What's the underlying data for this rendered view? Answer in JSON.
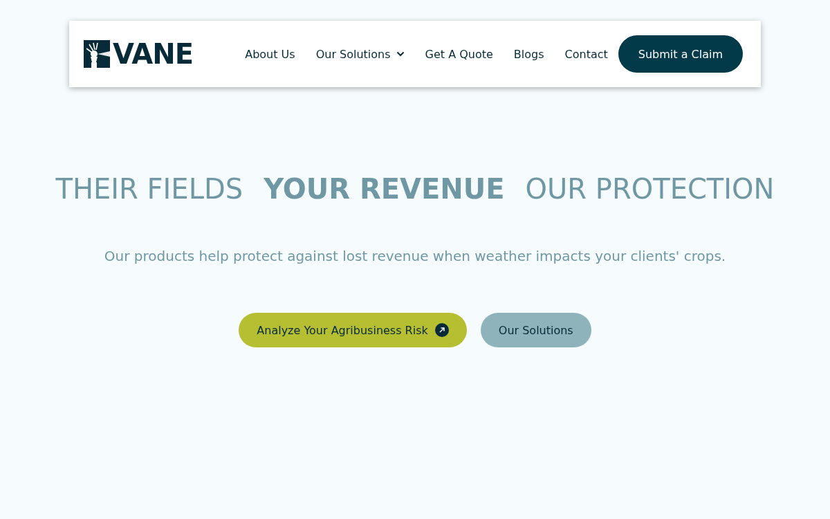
{
  "header": {
    "logo": "VANE",
    "nav": [
      {
        "label": "About Us",
        "dropdown": false
      },
      {
        "label": "Our Solutions",
        "dropdown": true
      },
      {
        "label": "Get A Quote",
        "dropdown": false
      },
      {
        "label": "Blogs",
        "dropdown": false
      },
      {
        "label": "Contact",
        "dropdown": false
      }
    ],
    "cta": "Submit a Claim"
  },
  "hero": {
    "headline": [
      "THEIR FIELDS",
      "YOUR REVENUE",
      "OUR PROTECTION"
    ],
    "subtitle": "Our products help protect against lost revenue when weather impacts your clients' crops.",
    "buttons": [
      {
        "label": "Analyze Your Agribusiness Risk",
        "kind": "primary"
      },
      {
        "label": "Our Solutions",
        "kind": "secondary"
      }
    ]
  }
}
